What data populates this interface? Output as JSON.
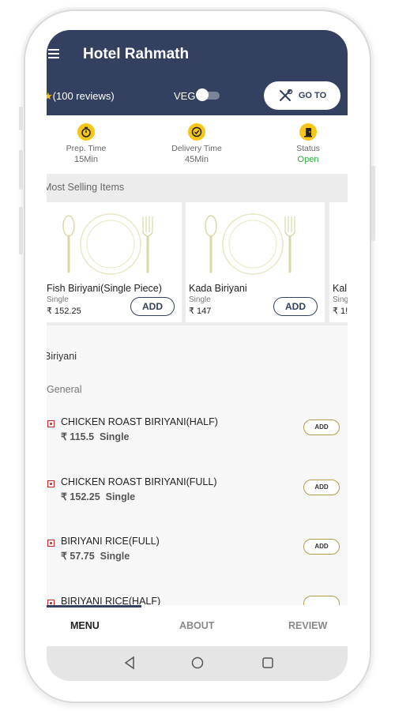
{
  "header": {
    "title": "Hotel Rahmath",
    "reviews": "(100 reviews)",
    "veg_label": "VEG",
    "goto_label": "GO TO"
  },
  "info": [
    {
      "label": "Prep. Time",
      "value": "15Min",
      "icon": "timer-icon"
    },
    {
      "label": "Delivery Time",
      "value": "45Min",
      "icon": "clock-icon"
    },
    {
      "label": "Status",
      "value": "Open",
      "icon": "door-icon"
    }
  ],
  "most_selling": {
    "title": "Most Selling Items",
    "items": [
      {
        "name": "Fish Biriyani(Single Piece)",
        "type": "Single",
        "price": "₹ 152.25",
        "add_label": "ADD"
      },
      {
        "name": "Kada Biriyani",
        "type": "Single",
        "price": "₹ 147",
        "add_label": "ADD"
      },
      {
        "name": "Kal",
        "type": "Sing",
        "price": "₹ 1!"
      }
    ]
  },
  "menu": {
    "category": "Biriyani",
    "subcategory": "General",
    "items": [
      {
        "name": "CHICKEN ROAST BIRIYANI(HALF)",
        "price": "₹ 115.5",
        "type": "Single",
        "add_label": "ADD"
      },
      {
        "name": "CHICKEN ROAST BIRIYANI(FULL)",
        "price": "₹ 152.25",
        "type": "Single",
        "add_label": "ADD"
      },
      {
        "name": "BIRIYANI RICE(FULL)",
        "price": "₹ 57.75",
        "type": "Single",
        "add_label": "ADD"
      },
      {
        "name": "BIRIYANI RICE(HALF)",
        "price": "",
        "type": "",
        "add_label": ""
      }
    ]
  },
  "tabs": [
    "MENU",
    "ABOUT",
    "REVIEW"
  ],
  "colors": {
    "header": "#33405f",
    "accent": "#f5c518",
    "open": "#2eaa3e",
    "veg_mark": "#c62828"
  }
}
